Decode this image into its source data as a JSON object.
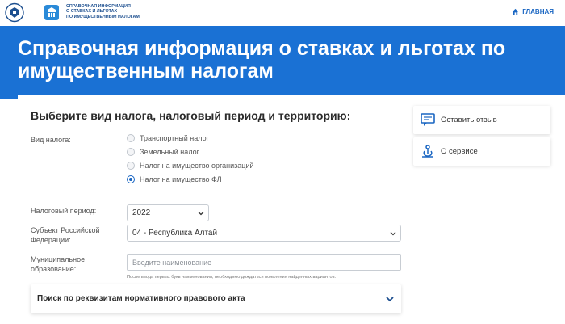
{
  "header": {
    "logo_lines": [
      "СПРАВОЧНАЯ ИНФОРМАЦИЯ",
      "О СТАВКАХ И ЛЬГОТАХ",
      "ПО ИМУЩЕСТВЕННЫМ НАЛОГАМ"
    ],
    "home_label": "ГЛАВНАЯ"
  },
  "banner": {
    "title": "Справочная информация о ставках и льготах по имущественным налогам"
  },
  "form": {
    "section_title": "Выберите вид налога, налоговый период и территорию:",
    "tax_type_label": "Вид налога:",
    "tax_types": [
      {
        "label": "Транспортный налог",
        "checked": false
      },
      {
        "label": "Земельный налог",
        "checked": false
      },
      {
        "label": "Налог на имущество организаций",
        "checked": false
      },
      {
        "label": "Налог на имущество ФЛ",
        "checked": true
      }
    ],
    "period_label": "Налоговый период:",
    "period_value": "2022",
    "subject_label_1": "Субъект Российской",
    "subject_label_2": "Федерации:",
    "subject_value": "04 - Республика Алтай",
    "municipal_label_1": "Муниципальное",
    "municipal_label_2": "образование:",
    "municipal_placeholder": "Введите наименование",
    "municipal_hint": "После ввода первых букв наименования, необходимо дождаться появления найденных вариантов.",
    "search_accordion": "Поиск по реквизитам нормативного правового акта"
  },
  "sidebar": {
    "feedback_label": "Оставить отзыв",
    "about_label": "О сервисе"
  },
  "colors": {
    "accent": "#1a71d4",
    "link": "#1a66c2"
  }
}
